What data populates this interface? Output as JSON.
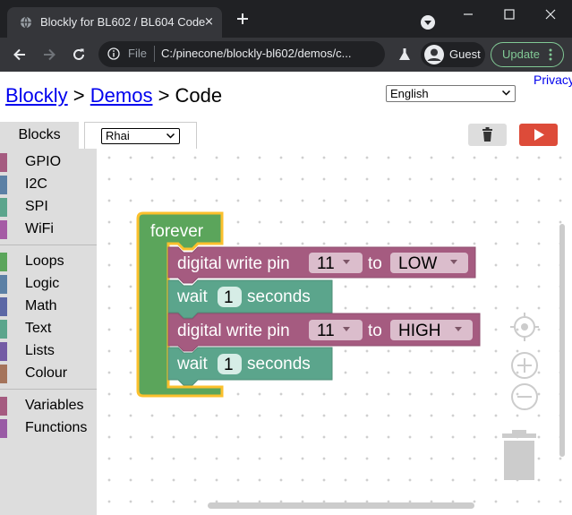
{
  "browser": {
    "tab_title": "Blockly for BL602 / BL604 Code",
    "tab_close": "×",
    "omnibox_scheme": "File",
    "url": "C:/pinecone/blockly-bl602/demos/c...",
    "profile_name": "Guest",
    "update_label": "Update"
  },
  "header": {
    "crumb_blockly": "Blockly",
    "sep1": " > ",
    "crumb_demos": "Demos",
    "sep2": " > ",
    "crumb_code": "Code",
    "language_selected": "English",
    "privacy": "Privacy"
  },
  "tabs": {
    "blocks": "Blocks",
    "code_language_selected": "Rhai"
  },
  "toolbox": {
    "items": [
      {
        "label": "GPIO",
        "color": "#a55b80"
      },
      {
        "label": "I2C",
        "color": "#5b80a5"
      },
      {
        "label": "SPI",
        "color": "#5ba58c"
      },
      {
        "label": "WiFi",
        "color": "#a55ba5"
      },
      {
        "label": "Loops",
        "color": "#5ba55b"
      },
      {
        "label": "Logic",
        "color": "#5b80a5"
      },
      {
        "label": "Math",
        "color": "#5b67a5"
      },
      {
        "label": "Text",
        "color": "#5ba58c"
      },
      {
        "label": "Lists",
        "color": "#745ba5"
      },
      {
        "label": "Colour",
        "color": "#a5745b"
      },
      {
        "label": "Variables",
        "color": "#a55b80"
      },
      {
        "label": "Functions",
        "color": "#995ba5"
      }
    ]
  },
  "program": {
    "forever_label": "forever",
    "dw1": {
      "prefix": "digital write pin",
      "pin": "11",
      "mid": "to",
      "level": "LOW"
    },
    "wait1": {
      "prefix": "wait",
      "value": "1",
      "suffix": "seconds"
    },
    "dw2": {
      "prefix": "digital write pin",
      "pin": "11",
      "mid": "to",
      "level": "HIGH"
    },
    "wait2": {
      "prefix": "wait",
      "value": "1",
      "suffix": "seconds"
    }
  },
  "colors": {
    "loop_block": "#5ba55b",
    "loop_highlight": "#fbc02d",
    "gpio_block": "#a55b80",
    "gpio_field": "#dbbdcc",
    "time_block": "#5ba58c",
    "time_field": "#d6ede6",
    "run_button": "#dd4b39"
  }
}
